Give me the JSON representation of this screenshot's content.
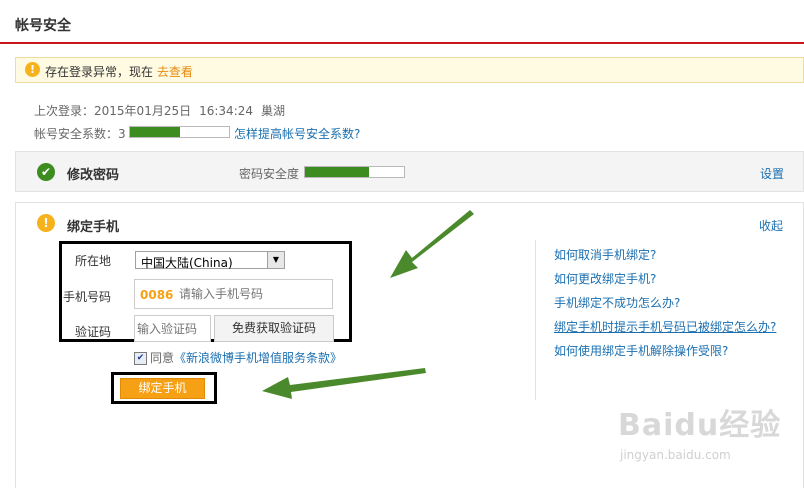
{
  "header": {
    "title": "帐号安全"
  },
  "alert": {
    "icon": "exclamation-icon",
    "text": "存在登录异常，现在",
    "link": "去查看"
  },
  "last_login": {
    "label": "上次登录：",
    "date": "2015年01月25日",
    "time": "16:34:24",
    "location": "巢湖"
  },
  "security": {
    "label": "帐号安全系数：",
    "score": "3",
    "level": 0.5,
    "link": "怎样提高帐号安全系数?"
  },
  "password": {
    "title": "修改密码",
    "strength_label": "密码安全度",
    "strength_level": 0.65,
    "action": "设置"
  },
  "bind": {
    "title": "绑定手机",
    "collapse": "收起",
    "location_label": "所在地",
    "location_value": "中国大陆(China)",
    "phone_label": "手机号码",
    "phone_prefix": "0086",
    "phone_placeholder": "请输入手机号码",
    "code_label": "验证码",
    "code_placeholder": "输入验证码",
    "get_code": "免费获取验证码",
    "agree_text": "同意",
    "agree_link": "《新浪微博手机增值服务条款》",
    "submit": "绑定手机"
  },
  "help": [
    "如何取消手机绑定?",
    "如何更改绑定手机?",
    "手机绑定不成功怎么办?",
    "绑定手机时提示手机号码已被绑定怎么办?",
    "如何使用绑定手机解除操作受限?"
  ],
  "watermark": {
    "logo": "Baidu经验",
    "url": "jingyan.baidu.com"
  },
  "colors": {
    "accent": "#c8161d",
    "progress": "#3d8c1f",
    "button": "#f6a015",
    "link": "#1a6fb0"
  }
}
